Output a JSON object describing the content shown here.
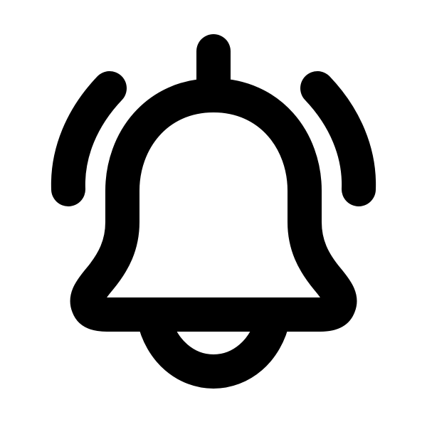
{
  "icon": {
    "name": "bell-ringing-icon",
    "stroke_color": "#000000",
    "background_color": "#ffffff"
  }
}
